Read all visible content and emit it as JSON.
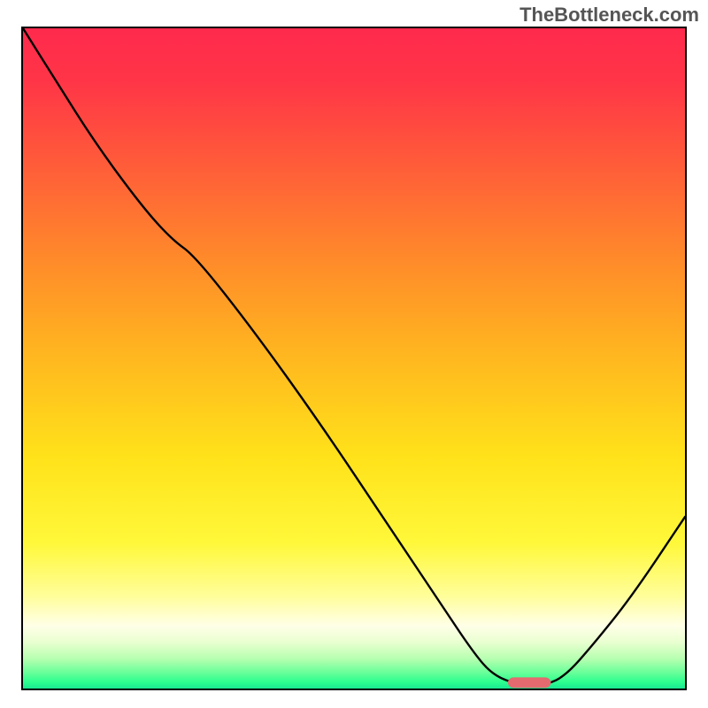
{
  "watermark": "TheBottleneck.com",
  "chart_data": {
    "type": "line",
    "title": "",
    "xlabel": "",
    "ylabel": "",
    "xlim": [
      0,
      100
    ],
    "ylim": [
      0,
      100
    ],
    "annotations": [],
    "gradient_stops": [
      {
        "offset": 0.0,
        "color": "#ff2a4d"
      },
      {
        "offset": 0.08,
        "color": "#ff3547"
      },
      {
        "offset": 0.2,
        "color": "#ff5a3a"
      },
      {
        "offset": 0.35,
        "color": "#ff8a2a"
      },
      {
        "offset": 0.5,
        "color": "#ffb81f"
      },
      {
        "offset": 0.65,
        "color": "#ffe21a"
      },
      {
        "offset": 0.78,
        "color": "#fff83a"
      },
      {
        "offset": 0.86,
        "color": "#fffe9a"
      },
      {
        "offset": 0.905,
        "color": "#ffffe8"
      },
      {
        "offset": 0.93,
        "color": "#e9ffd0"
      },
      {
        "offset": 0.955,
        "color": "#b6ffb0"
      },
      {
        "offset": 0.975,
        "color": "#6cff9a"
      },
      {
        "offset": 0.99,
        "color": "#2dff90"
      },
      {
        "offset": 1.0,
        "color": "#19e890"
      }
    ],
    "series": [
      {
        "name": "bottleneck-curve",
        "x": [
          0.0,
          5.0,
          11.0,
          18.0,
          22.5,
          26.0,
          35.0,
          45.0,
          55.0,
          63.0,
          68.0,
          71.0,
          75.0,
          79.0,
          82.0,
          86.0,
          92.0,
          100.0
        ],
        "y": [
          100.0,
          92.0,
          82.5,
          73.0,
          68.0,
          65.5,
          54.0,
          40.0,
          25.0,
          13.0,
          5.5,
          2.0,
          0.5,
          0.5,
          2.0,
          6.5,
          14.0,
          26.0
        ]
      }
    ],
    "marker": {
      "name": "optimal-marker",
      "x": 76.5,
      "y": 0.9,
      "width": 6.5,
      "height": 1.6,
      "color": "#e46a6f"
    }
  }
}
